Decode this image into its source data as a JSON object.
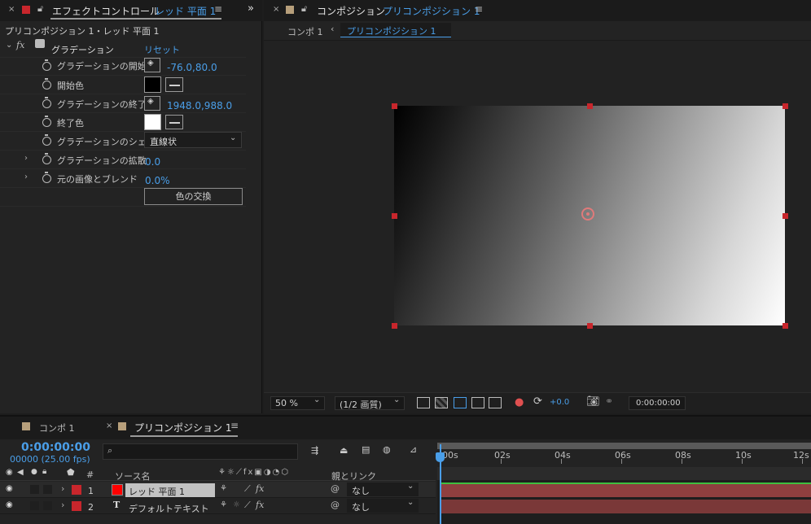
{
  "effect_panel": {
    "tab_prefix": "エフェクトコントロール",
    "tab_layer": "レッド 平面 1",
    "breadcrumb": "プリコンポジション 1・レッド 平面 1",
    "effect_name": "グラデーション",
    "reset": "リセット",
    "rows": [
      {
        "label": "グラデーションの開始",
        "value": "-76.0,80.0"
      },
      {
        "label": "開始色"
      },
      {
        "label": "グラデーションの終了",
        "value": "1948.0,988.0"
      },
      {
        "label": "終了色"
      },
      {
        "label": "グラデーションのシェ",
        "value": "直線状"
      },
      {
        "label": "グラデーションの拡散",
        "value": "0.0"
      },
      {
        "label": "元の画像とブレンド",
        "value": "0.0%"
      }
    ],
    "swap_button": "色の交換",
    "start_color": "#000000",
    "end_color": "#ffffff"
  },
  "comp_panel": {
    "tab_prefix": "コンポジション",
    "tab_name": "プリコンポジション 1",
    "crumb1": "コンポ 1",
    "crumb2": "プリコンポジション 1",
    "zoom": "50 %",
    "resolution": "(1/2 画質)",
    "exposure": "+0.0",
    "timecode": "0:00:00:00"
  },
  "timeline": {
    "tab1": "コンポ 1",
    "tab2": "プリコンポジション 1",
    "timecode": "0:00:00:00",
    "frames": "00000 (25.00 fps)",
    "search_placeholder": "",
    "col_num": "#",
    "col_source": "ソース名",
    "col_parent": "親とリンク",
    "ticks": [
      "00s",
      "02s",
      "04s",
      "06s",
      "08s",
      "10s",
      "12s"
    ],
    "layers": [
      {
        "num": "1",
        "name": "レッド 平面 1",
        "parent": "なし",
        "color": "#c8262c"
      },
      {
        "num": "2",
        "name": "デフォルトテキスト",
        "parent": "なし",
        "color": "#c8262c"
      }
    ]
  },
  "colors": {
    "accent": "#4a9ee8",
    "layer_bar": "#8f3f3f",
    "handle": "#c8262c"
  }
}
